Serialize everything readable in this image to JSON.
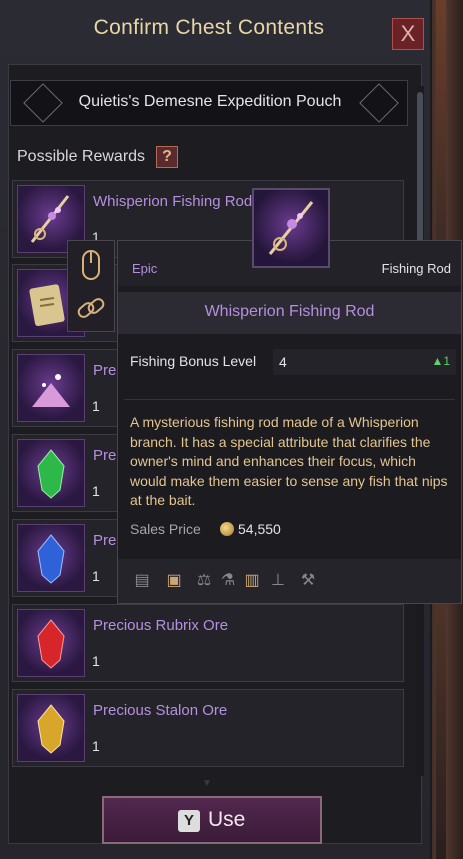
{
  "window": {
    "title": "Confirm Chest Contents",
    "close_glyph": "X",
    "banner_title": "Quietis's Demesne Expedition Pouch"
  },
  "rewards": {
    "header": "Possible Rewards",
    "help_glyph": "?",
    "items": [
      {
        "name": "Whisperion Fishing Rod",
        "qty": "1",
        "icon": "fishing-rod-icon"
      },
      {
        "name": "",
        "qty": "",
        "icon": "scroll-icon"
      },
      {
        "name": "Pre",
        "qty": "1",
        "icon": "pink-dust-icon"
      },
      {
        "name": "Pre",
        "qty": "1",
        "icon": "green-ore-icon"
      },
      {
        "name": "Pre",
        "qty": "1",
        "icon": "blue-ore-icon"
      },
      {
        "name": "Precious Rubrix Ore",
        "qty": "1",
        "icon": "red-ore-icon"
      },
      {
        "name": "Precious Stalon Ore",
        "qty": "1",
        "icon": "yellow-ore-icon"
      }
    ]
  },
  "use_button": {
    "key": "Y",
    "label": "Use"
  },
  "tooltip": {
    "rarity": "Epic",
    "type": "Fishing Rod",
    "name": "Whisperion Fishing Rod",
    "stat_label": "Fishing Bonus Level",
    "stat_value": "4",
    "stat_change": "▲1",
    "description": "A mysterious fishing rod made of a Whisperion branch. It has a special attribute that clarifies the owner's mind and enhances their focus, which would make them easier to sense any fish that nips at the bait.",
    "price_label": "Sales Price",
    "price_value": "54,550",
    "action_icons": [
      "book-icon",
      "crate-icon",
      "scale-icon",
      "flask-icon",
      "trash-icon",
      "anvil-icon",
      "hammer-icon"
    ]
  },
  "colors": {
    "title": "#e8d7a6",
    "epic": "#b58fe0",
    "description": "#e3c58f",
    "stat_up": "#5fd06a",
    "use_button": "#53284f"
  }
}
